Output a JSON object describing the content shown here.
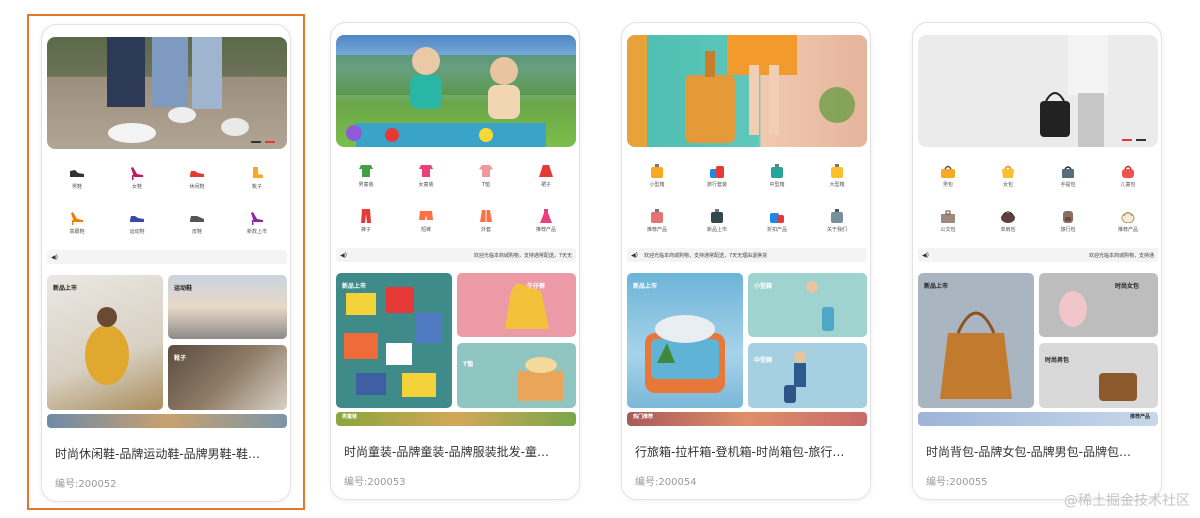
{
  "cards": [
    {
      "selected": true,
      "icons": [
        {
          "icon": "sneaker-icon",
          "label": "男鞋",
          "color": "#333"
        },
        {
          "icon": "high-heel-icon",
          "label": "女鞋",
          "color": "#c2185b"
        },
        {
          "icon": "sneaker-icon",
          "label": "休闲鞋",
          "color": "#e53935"
        },
        {
          "icon": "boot-icon",
          "label": "靴子",
          "color": "#f9a825"
        },
        {
          "icon": "high-heel-icon",
          "label": "高跟鞋",
          "color": "#f57c00"
        },
        {
          "icon": "sneaker-icon",
          "label": "运动鞋",
          "color": "#3949ab"
        },
        {
          "icon": "leather-shoe-icon",
          "label": "皮鞋",
          "color": "#555"
        },
        {
          "icon": "high-heel-icon",
          "label": "新款上市",
          "color": "#8e24aa"
        }
      ],
      "notice": "",
      "tiles": [
        "新品上市",
        "运动鞋",
        "靴子"
      ],
      "strip": "",
      "title": "时尚休闲鞋-品牌运动鞋-品牌男鞋-鞋…",
      "code": "编号:200052"
    },
    {
      "selected": false,
      "icons": [
        {
          "icon": "kids-set-icon",
          "label": "男童装",
          "color": "#43a047"
        },
        {
          "icon": "kids-set-icon",
          "label": "女童装",
          "color": "#ec407a"
        },
        {
          "icon": "tshirt-icon",
          "label": "T恤",
          "color": "#ef9a9a"
        },
        {
          "icon": "skirt-icon",
          "label": "裙子",
          "color": "#e53935"
        },
        {
          "icon": "pants-icon",
          "label": "裤子",
          "color": "#e53935"
        },
        {
          "icon": "shorts-icon",
          "label": "短裤",
          "color": "#ff7043"
        },
        {
          "icon": "jacket-icon",
          "label": "外套",
          "color": "#ff7043"
        },
        {
          "icon": "dress-icon",
          "label": "推荐产品",
          "color": "#ec407a"
        }
      ],
      "notice": "欢迎光临本商城购物，支持通常配送，7天无",
      "tiles": [
        "新品上市",
        "牛仔裤",
        "T恤"
      ],
      "strip": "男童装",
      "title": "时尚童装-品牌童装-品牌服装批发-童…",
      "code": "编号:200053"
    },
    {
      "selected": false,
      "icons": [
        {
          "icon": "suitcase-icon",
          "label": "小型箱",
          "color": "#f9a825"
        },
        {
          "icon": "suitcase-icon",
          "label": "旅行套装",
          "color": "#e53935"
        },
        {
          "icon": "suitcase-icon",
          "label": "中型箱",
          "color": "#26a69a"
        },
        {
          "icon": "suitcase-icon",
          "label": "大型箱",
          "color": "#fbc02d"
        },
        {
          "icon": "suitcase-icon",
          "label": "推荐产品",
          "color": "#e57373"
        },
        {
          "icon": "suitcase-icon",
          "label": "新品上市",
          "color": "#37474f"
        },
        {
          "icon": "suitcase-icon",
          "label": "折扣产品",
          "color": "#1e88e5"
        },
        {
          "icon": "suitcase-icon",
          "label": "关于我们",
          "color": "#78909c"
        }
      ],
      "notice": "欢迎光临本商城购物，支持通常配送，7天无理由退换货",
      "tiles": [
        "新品上市",
        "小型箱",
        "中型箱"
      ],
      "strip": "热门推荐",
      "title": "行旅箱-拉杆箱-登机箱-时尚箱包-旅行…",
      "code": "编号:200054"
    },
    {
      "selected": false,
      "icons": [
        {
          "icon": "handbag-icon",
          "label": "男包",
          "color": "#f9a825"
        },
        {
          "icon": "handbag-icon",
          "label": "女包",
          "color": "#fbc02d"
        },
        {
          "icon": "handbag-icon",
          "label": "手提包",
          "color": "#546e7a"
        },
        {
          "icon": "handbag-icon",
          "label": "儿童包",
          "color": "#ef5350"
        },
        {
          "icon": "handbag-icon",
          "label": "公文包",
          "color": "#a1887f"
        },
        {
          "icon": "handbag-icon",
          "label": "单肩包",
          "color": "#5d4037"
        },
        {
          "icon": "backpack-icon",
          "label": "旅行包",
          "color": "#8d6e63"
        },
        {
          "icon": "handbag-icon",
          "label": "推荐产品",
          "color": "#d7ccc8"
        }
      ],
      "notice": "欢迎光临本商城购物，支持通",
      "tiles": [
        "新品上市",
        "时尚女包",
        "时尚男包"
      ],
      "strip": "推荐产品",
      "title": "时尚背包-品牌女包-品牌男包-品牌包…",
      "code": "编号:200055"
    }
  ],
  "watermark": "@稀土掘金技术社区",
  "colors": {
    "accent": "#e8752a"
  }
}
